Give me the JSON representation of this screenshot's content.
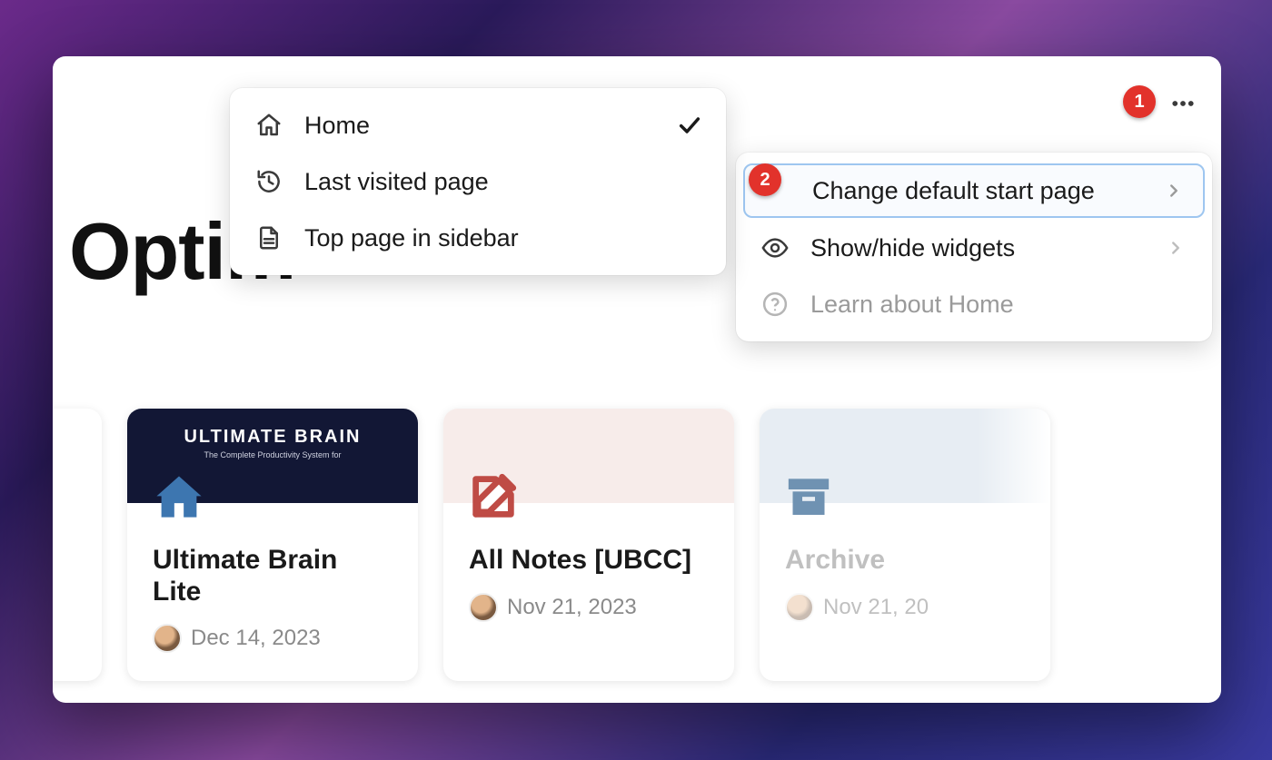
{
  "page": {
    "title_visible": "Optim"
  },
  "callouts": {
    "one": "1",
    "two": "2"
  },
  "start_page_menu": {
    "items": [
      {
        "label": "Home",
        "icon": "home-icon",
        "selected": true
      },
      {
        "label": "Last visited page",
        "icon": "history-icon",
        "selected": false
      },
      {
        "label": "Top page in sidebar",
        "icon": "page-icon",
        "selected": false
      }
    ]
  },
  "overflow_menu": {
    "items": [
      {
        "label": "Change default start page",
        "icon": "blank",
        "has_submenu": true,
        "highlight": true
      },
      {
        "label": "Show/hide widgets",
        "icon": "eye-icon",
        "has_submenu": true
      },
      {
        "label": "Learn about Home",
        "icon": "help-icon",
        "muted": true
      }
    ]
  },
  "cards": [
    {
      "title": "Ultimate Brain Lite",
      "date": "Dec 14, 2023",
      "cover": "dark",
      "cover_brand_text": "ULTIMATE BRAIN",
      "cover_brand_sub": "The Complete Productivity System for",
      "icon": "house-solid-icon",
      "icon_color": "#3d76b0"
    },
    {
      "title": "All Notes [UBCC]",
      "date": "Nov 21, 2023",
      "cover": "pink",
      "icon": "edit-icon",
      "icon_color": "#bf4b45"
    },
    {
      "title": "Archive",
      "date": "Nov 21, 20",
      "cover": "blue",
      "icon": "archive-icon",
      "icon_color": "#6f92b2",
      "faded": true
    }
  ]
}
